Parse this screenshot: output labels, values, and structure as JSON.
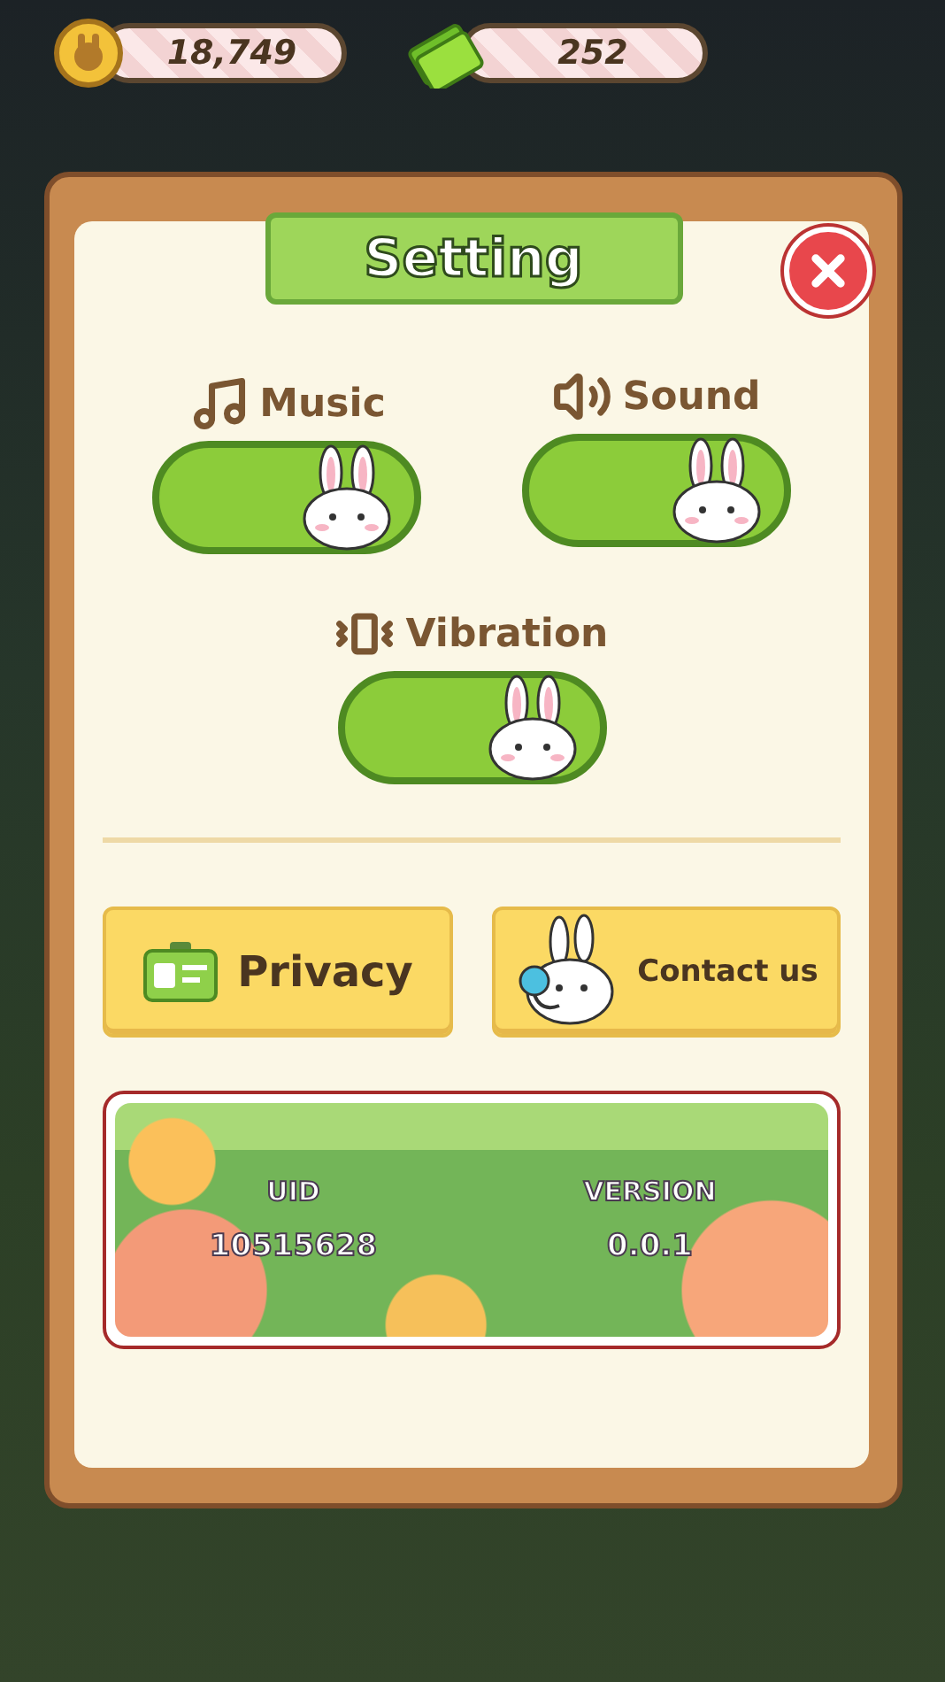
{
  "currencies": [
    {
      "kind": "coin",
      "amount": "18,749"
    },
    {
      "kind": "cash",
      "amount": "252"
    }
  ],
  "dialog": {
    "title": "Setting"
  },
  "toggles": [
    {
      "label": "Music",
      "kind": "music",
      "on": true
    },
    {
      "label": "Sound",
      "kind": "sound",
      "on": true
    },
    {
      "label": "Vibration",
      "kind": "vibration",
      "on": true
    }
  ],
  "buttons": [
    {
      "label": "Privacy",
      "kind": "privacy"
    },
    {
      "label": "Contact us",
      "kind": "contact"
    }
  ],
  "info": [
    {
      "label": "UID",
      "value": "10515628"
    },
    {
      "label": "VERSION",
      "value": "0.0.1"
    }
  ]
}
